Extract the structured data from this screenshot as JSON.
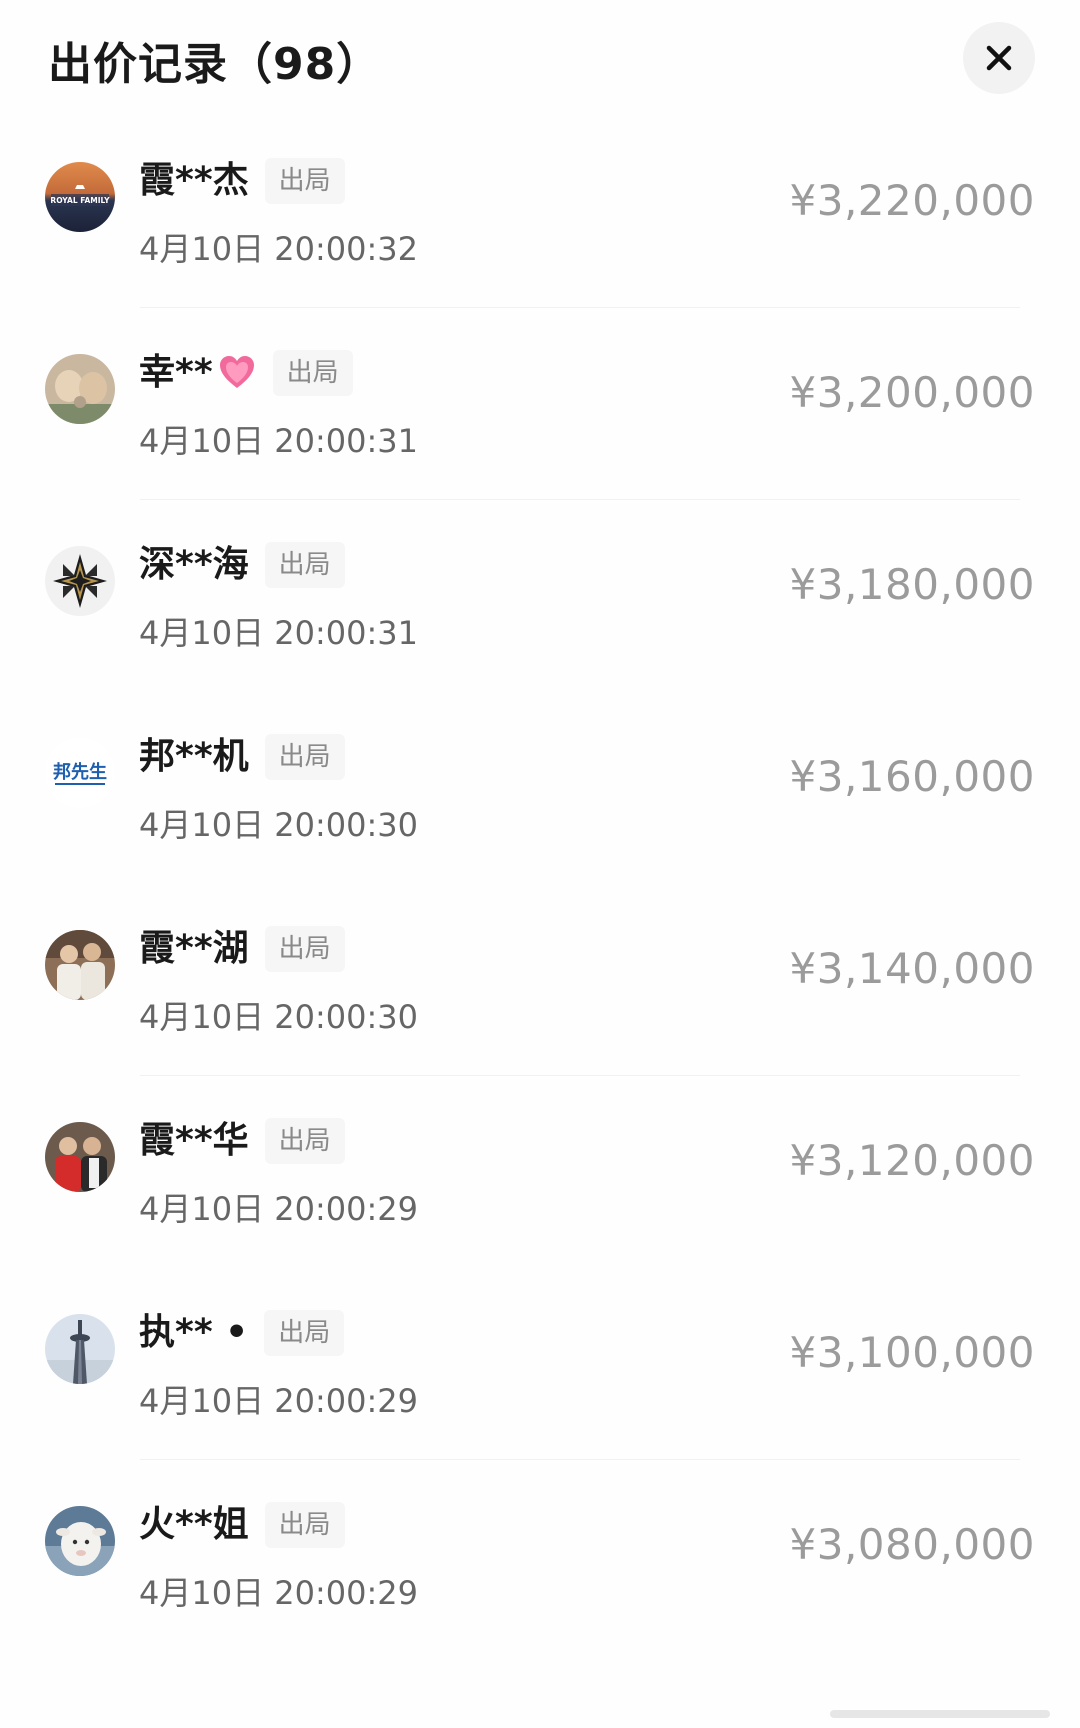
{
  "header": {
    "title": "出价记录（98）",
    "close_icon": "close-icon"
  },
  "records": [
    {
      "name": "霞**杰",
      "emoji": "",
      "tag": "出局",
      "time": "4月10日 20:00:32",
      "amount": "¥3,220,000",
      "avatar": "royal-family-logo"
    },
    {
      "name": "幸**",
      "emoji": "heart-icon",
      "tag": "出局",
      "time": "4月10日 20:00:31",
      "amount": "¥3,200,000",
      "avatar": "photo-avatar"
    },
    {
      "name": "深**海",
      "emoji": "",
      "tag": "出局",
      "time": "4月10日 20:00:31",
      "amount": "¥3,180,000",
      "avatar": "geometric-logo"
    },
    {
      "name": "邦**机",
      "emoji": "",
      "tag": "出局",
      "time": "4月10日 20:00:30",
      "amount": "¥3,160,000",
      "avatar": "text-logo",
      "avatar_text": "邦先生"
    },
    {
      "name": "霞**湖",
      "emoji": "",
      "tag": "出局",
      "time": "4月10日 20:00:30",
      "amount": "¥3,140,000",
      "avatar": "people-photo"
    },
    {
      "name": "霞**华",
      "emoji": "",
      "tag": "出局",
      "time": "4月10日 20:00:29",
      "amount": "¥3,120,000",
      "avatar": "people-photo"
    },
    {
      "name": "执** •",
      "emoji": "",
      "tag": "出局",
      "time": "4月10日 20:00:29",
      "amount": "¥3,100,000",
      "avatar": "tower-photo"
    },
    {
      "name": "火**姐",
      "emoji": "",
      "tag": "出局",
      "time": "4月10日 20:00:29",
      "amount": "¥3,080,000",
      "avatar": "lamb-photo"
    }
  ]
}
